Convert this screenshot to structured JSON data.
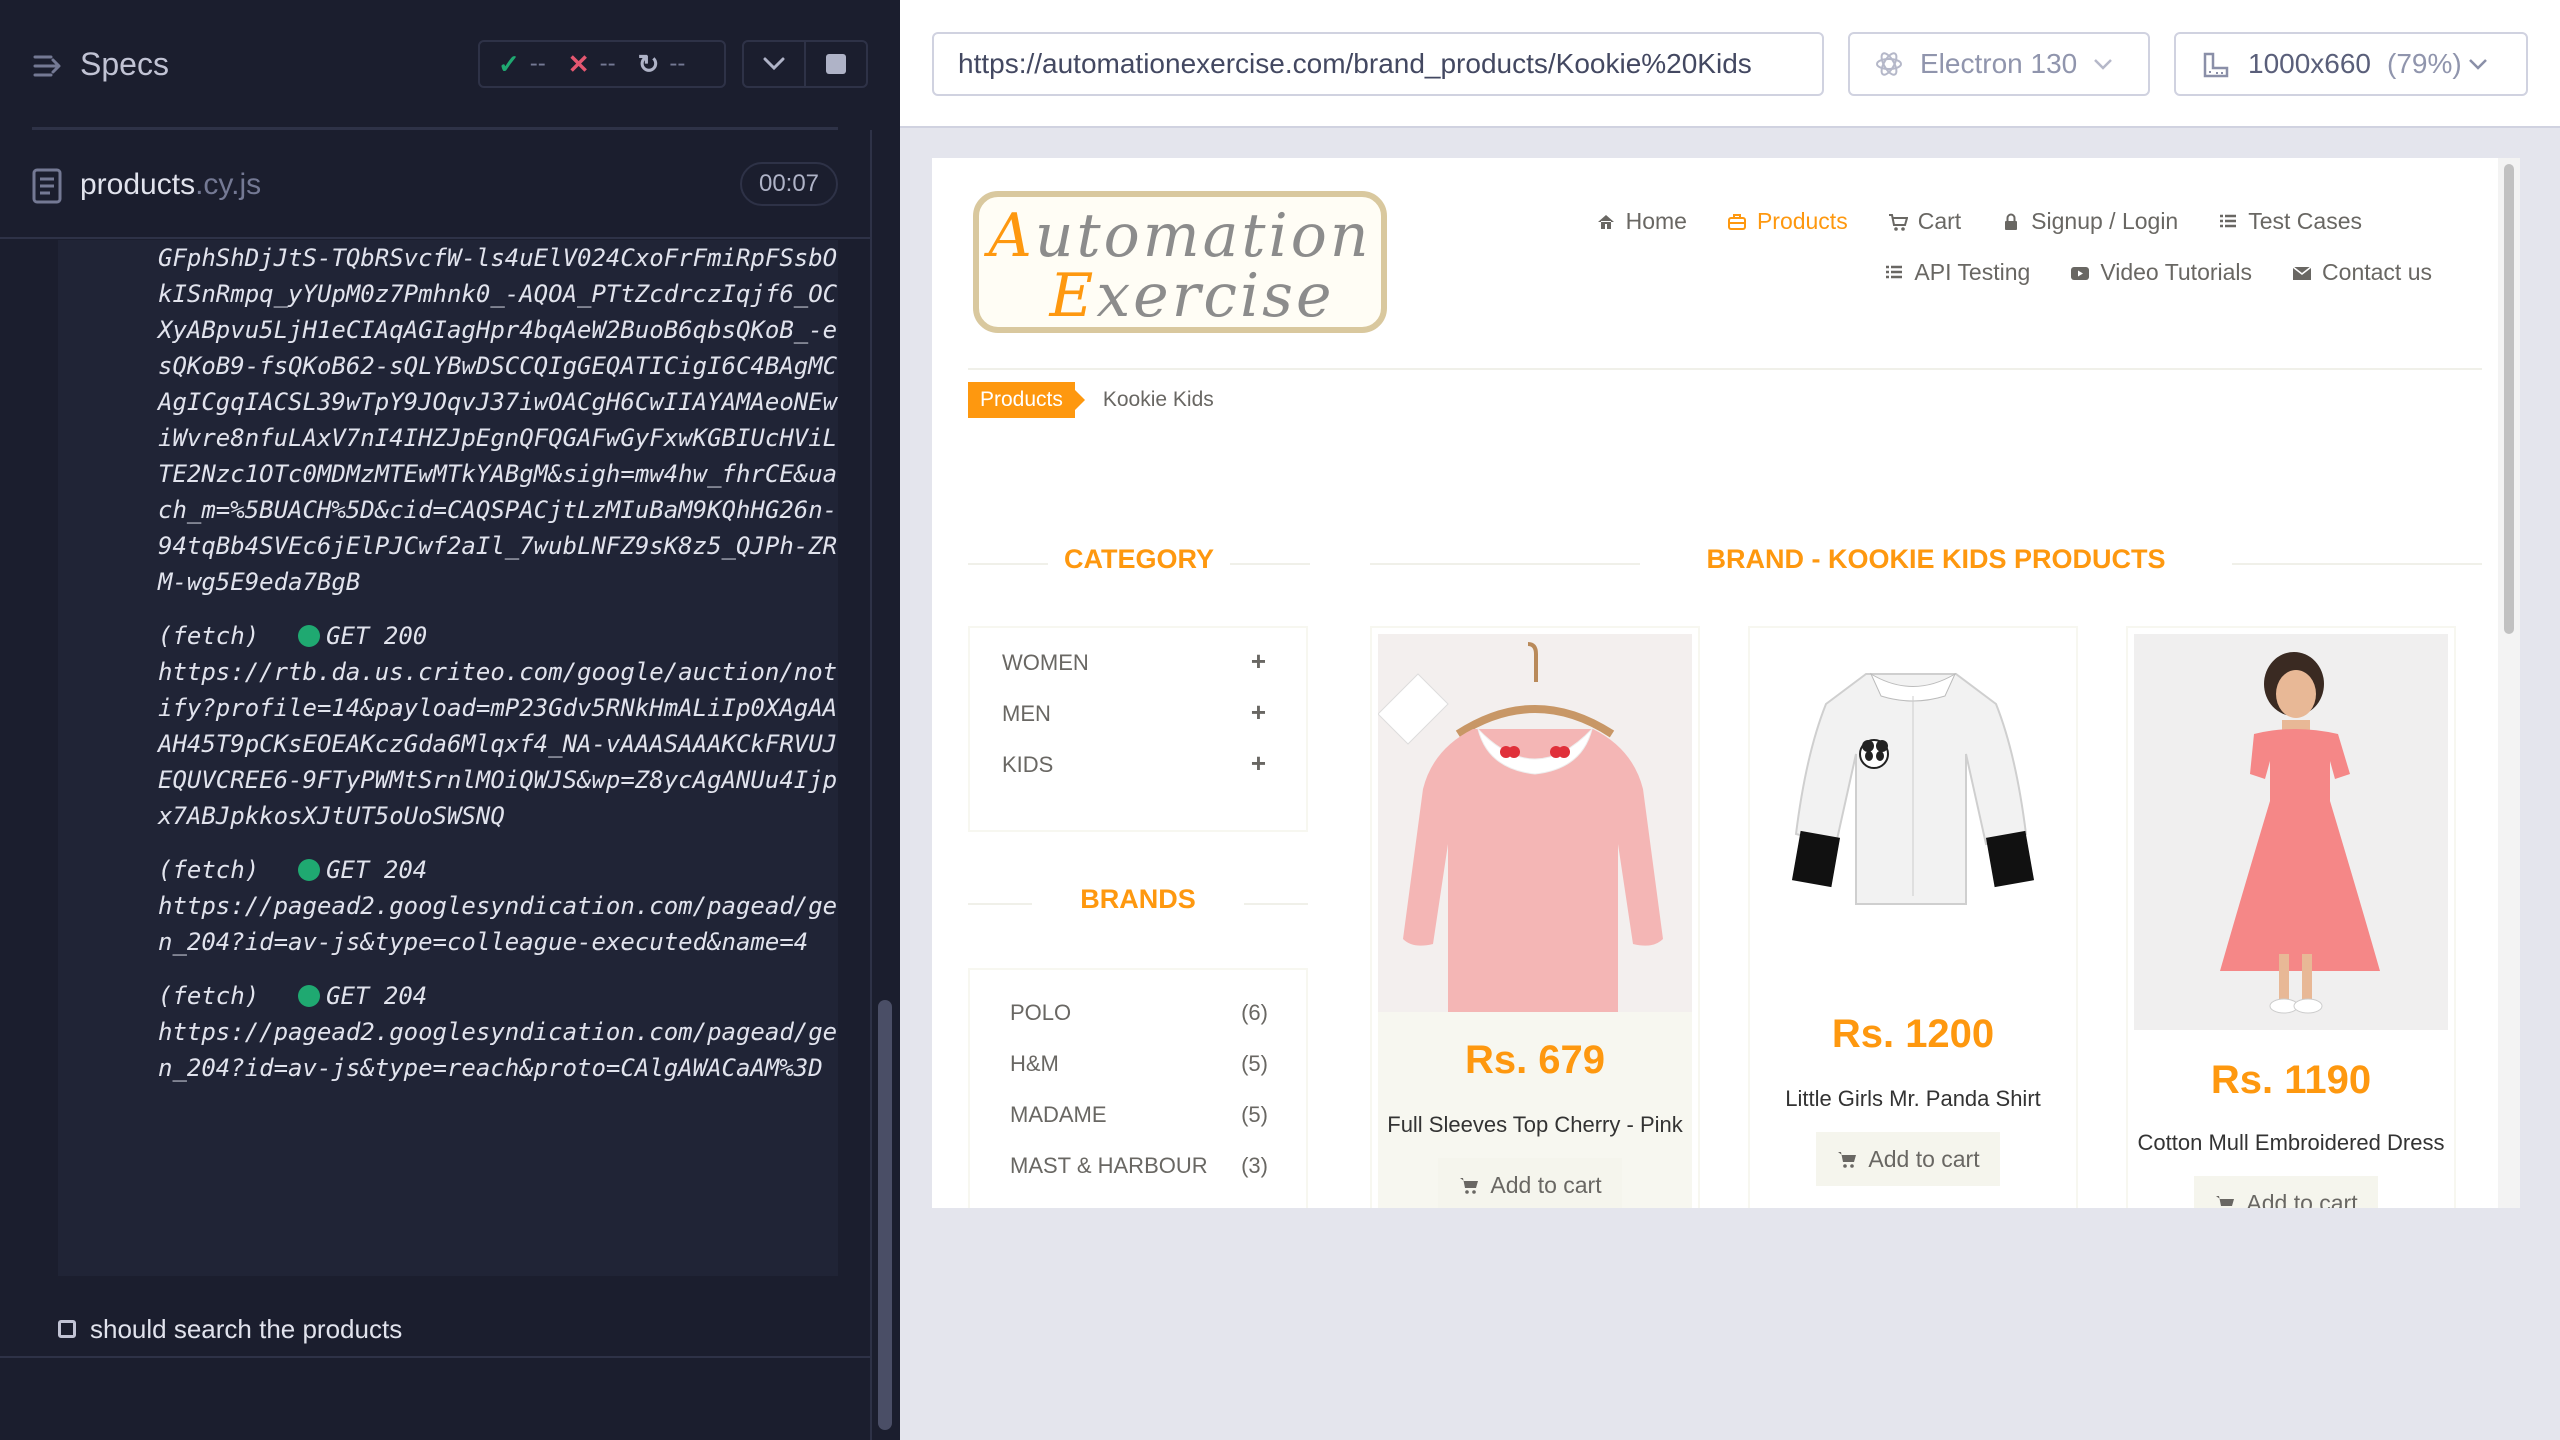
{
  "reporter": {
    "header_title": "Specs",
    "stats": {
      "passed": "--",
      "failed": "--",
      "pending": "--"
    },
    "spec_file": {
      "name": "products",
      "ext": ".cy.js",
      "time": "00:07"
    },
    "log_first_text": "GFphShDjJtS-TQbRSvcfW-ls4uElV024CxoFrFmiRpFSsbOkISnRmpq_yYUpM0z7Pmhnk0_-AQOA_PTtZcdrczIqjf6_OCXyABpvu5LjH1eCIAqAGIagHpr4bqAeW2BuoB6qbsQKoB_-esQKoB9-fsQKoB62-sQLYBwDSCCQIgGEQATICigI6C4BAgMCAgICgqIACSL39wTpY9JOqvJ37iwOACgH6CwIIAYAMAeoNEwiWvre8nfuLAxV7nI4IHZJpEgnQFQGAFwGyFxwKGBIUcHViLTE2Nzc1OTc0MDMzMTEwMTkYABgM&sigh=mw4hw_fhrCE&uach_m=%5BUACH%5D&cid=CAQSPACjtLzMIuBaM9KQhHG26n-94tqBb4SVEc6jElPJCwf2aIl_7wubLNFZ9sK8z5_QJPh-ZRM-wg5E9eda7BgB",
    "log_entries": [
      {
        "kind": "(fetch)",
        "method": "GET",
        "status": "200",
        "url": "https://rtb.da.us.criteo.com/google/auction/notify?profile=14&payload=mP23Gdv5RNkHmALiIp0XAgAAAH45T9pCKsEOEAKczGda6Mlqxf4_NA-vAAASAAAKCkFRVUJEQUVCREE6-9FTyPWMtSrnlMOiQWJS&wp=Z8ycAgANUu4Ijpx7ABJpkkosXJtUT5oUoSWSNQ"
      },
      {
        "kind": "(fetch)",
        "method": "GET",
        "status": "204",
        "url": "https://pagead2.googlesyndication.com/pagead/gen_204?id=av-js&type=colleague-executed&name=4"
      },
      {
        "kind": "(fetch)",
        "method": "GET",
        "status": "204",
        "url": "https://pagead2.googlesyndication.com/pagead/gen_204?id=av-js&type=reach&proto=CAlgAWACaAM%3D"
      }
    ],
    "next_test": "should search the products"
  },
  "aut": {
    "url": "https://automationexercise.com/brand_products/Kookie%20Kids",
    "browser": "Electron 130",
    "viewport": "1000x660",
    "zoom": "(79%)",
    "site": {
      "logo_line1": "Automation",
      "logo_line2": "Exercise",
      "nav": {
        "home": "Home",
        "products": "Products",
        "cart": "Cart",
        "login": "Signup / Login",
        "test_cases": "Test Cases",
        "api": "API Testing",
        "videos": "Video Tutorials",
        "contact": "Contact us"
      },
      "breadcrumb": {
        "parent": "Products",
        "current": "Kookie Kids"
      },
      "category_title": "CATEGORY",
      "categories": [
        "WOMEN",
        "MEN",
        "KIDS"
      ],
      "brands_title": "BRANDS",
      "brands": [
        {
          "name": "POLO",
          "count": "(6)"
        },
        {
          "name": "H&M",
          "count": "(5)"
        },
        {
          "name": "MADAME",
          "count": "(5)"
        },
        {
          "name": "MAST & HARBOUR",
          "count": "(3)"
        }
      ],
      "products_title": "BRAND - KOOKIE KIDS PRODUCTS",
      "add_to_cart": "Add to cart",
      "products": [
        {
          "price": "Rs. 679",
          "name": "Full Sleeves Top Cherry - Pink"
        },
        {
          "price": "Rs. 1200",
          "name": "Little Girls Mr. Panda Shirt"
        },
        {
          "price": "Rs. 1190",
          "name": "Cotton Mull Embroidered Dress"
        }
      ]
    }
  },
  "colors": {
    "accent": "#fe980f",
    "pass": "#1fa971",
    "fail": "#e45770",
    "reporter_bg": "#1b1e2e"
  }
}
